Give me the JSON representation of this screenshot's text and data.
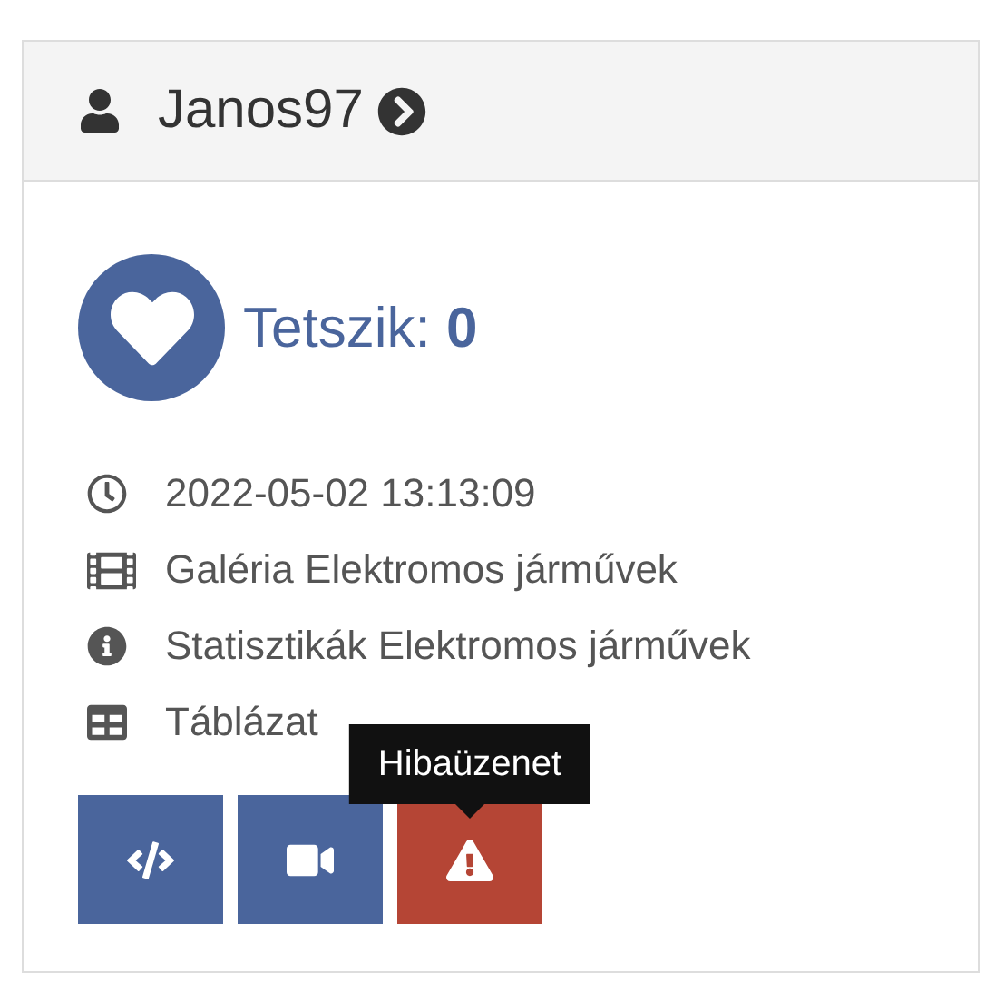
{
  "header": {
    "username": "Janos97"
  },
  "likes": {
    "label": "Tetszik:",
    "count": "0"
  },
  "details": [
    {
      "kind": "time",
      "text": "2022-05-02 13:13:09"
    },
    {
      "kind": "gallery",
      "text": "Galéria Elektromos járművek"
    },
    {
      "kind": "stats",
      "text": "Statisztikák Elektromos járművek"
    },
    {
      "kind": "table",
      "text": "Táblázat"
    }
  ],
  "buttons": [
    {
      "kind": "code"
    },
    {
      "kind": "video"
    },
    {
      "kind": "report",
      "tooltip": "Hibaüzenet"
    }
  ]
}
